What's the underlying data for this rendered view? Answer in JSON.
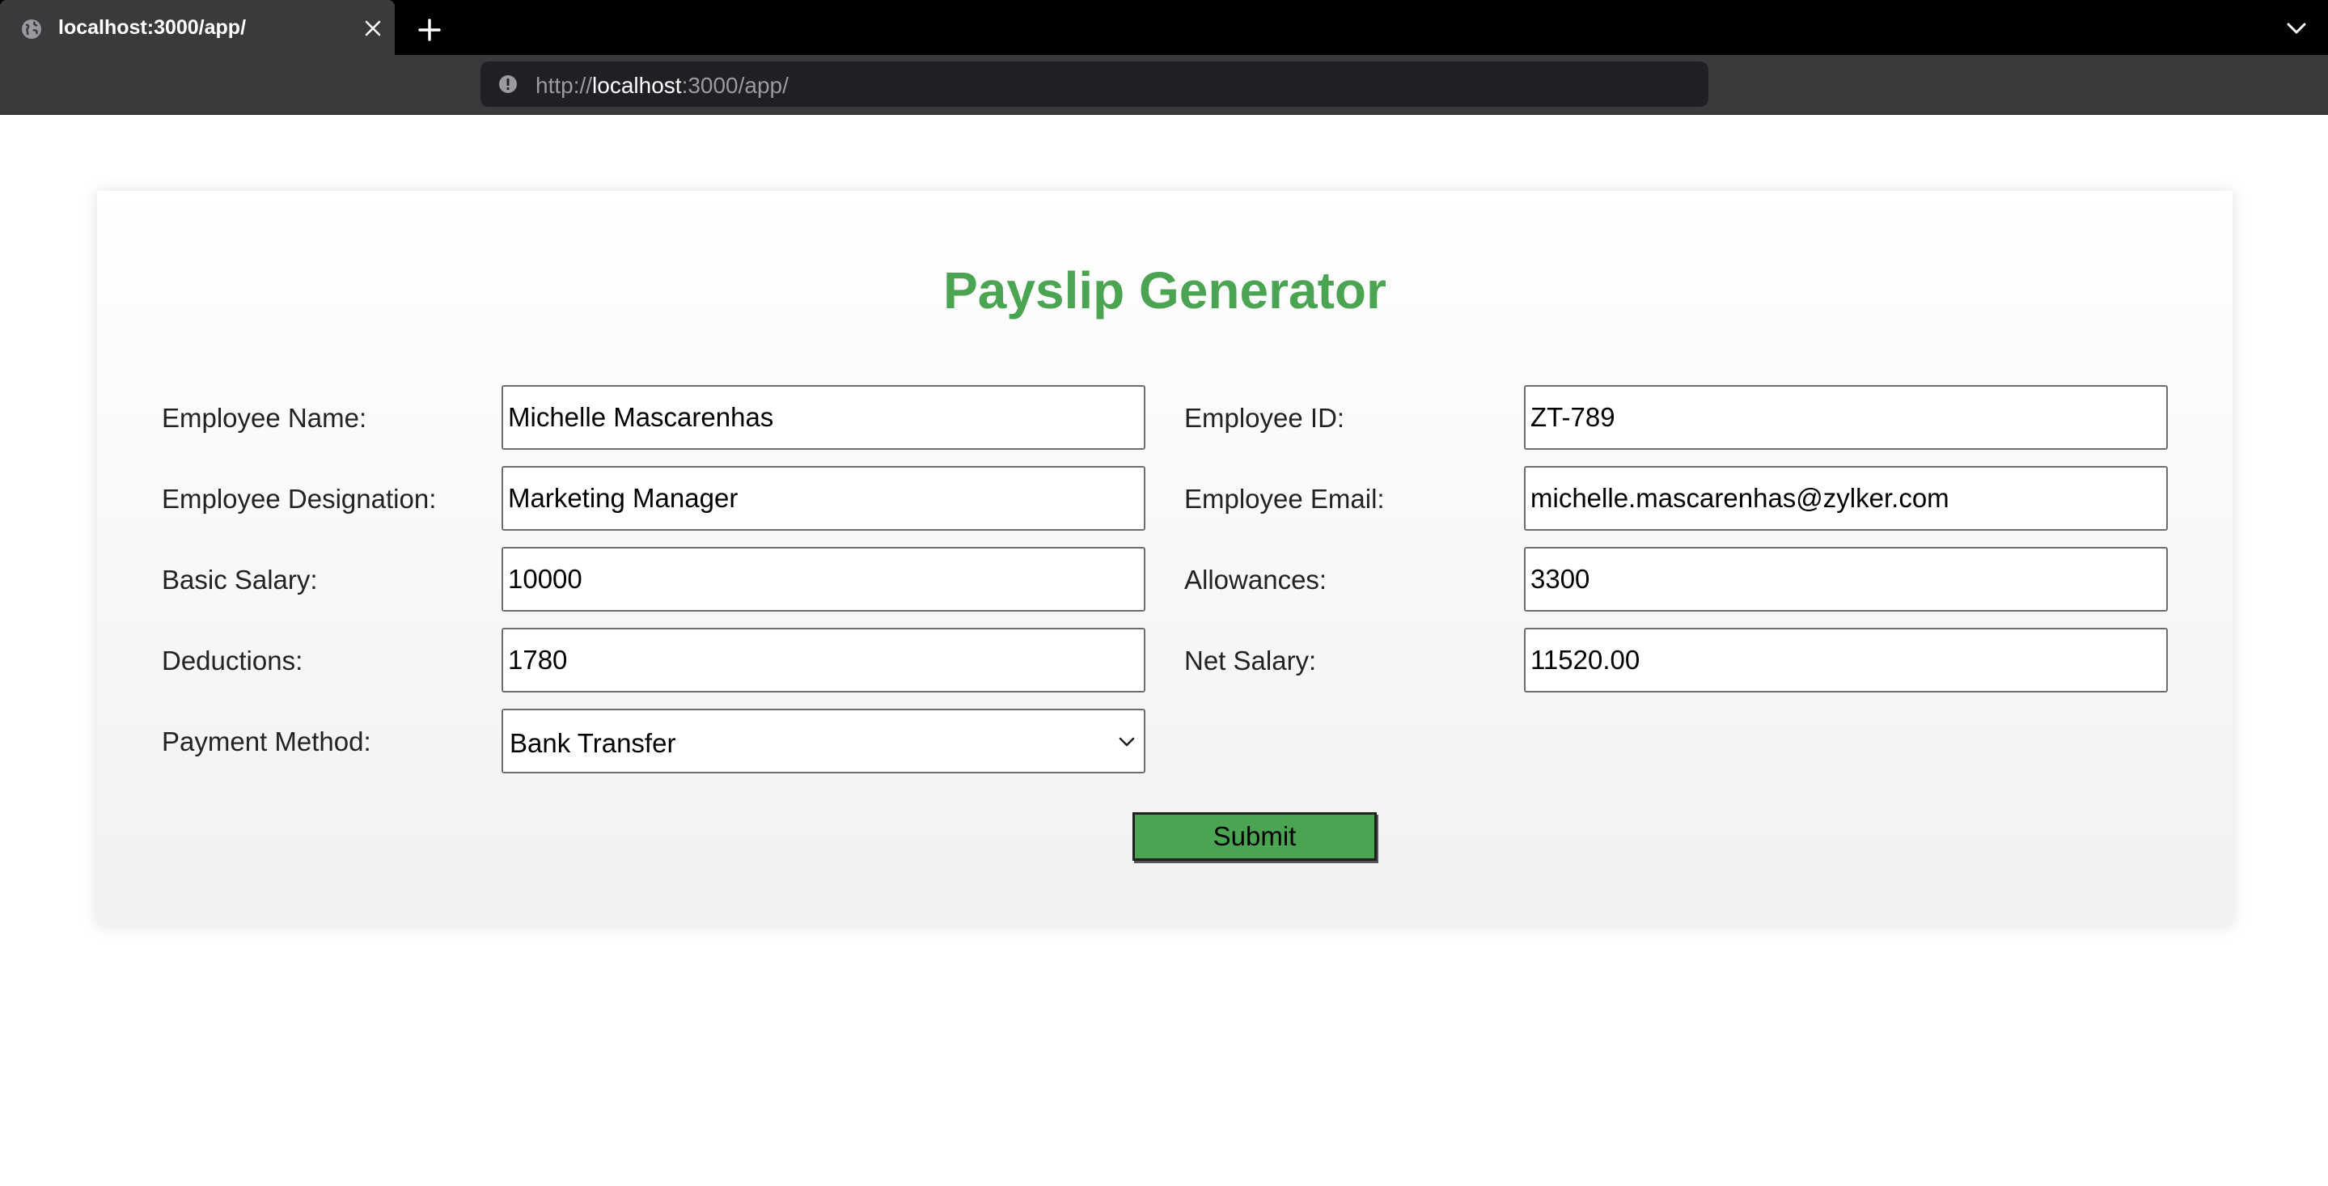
{
  "browser": {
    "tab_title": "localhost:3000/app/",
    "url_scheme": "http://",
    "url_host": "localhost",
    "url_rest": ":3000/app/"
  },
  "page": {
    "title": "Payslip Generator",
    "title_color": "#4aa451",
    "fields": {
      "employee_name": {
        "label": "Employee Name:",
        "value": "Michelle Mascarenhas"
      },
      "employee_id": {
        "label": "Employee ID:",
        "value": "ZT-789"
      },
      "employee_designation": {
        "label": "Employee Designation:",
        "value": "Marketing Manager"
      },
      "employee_email": {
        "label": "Employee Email:",
        "value": "michelle.mascarenhas@zylker.com"
      },
      "basic_salary": {
        "label": "Basic Salary:",
        "value": "10000"
      },
      "allowances": {
        "label": "Allowances:",
        "value": "3300"
      },
      "deductions": {
        "label": "Deductions:",
        "value": "1780"
      },
      "net_salary": {
        "label": "Net Salary:",
        "value": "11520.00"
      },
      "payment_method": {
        "label": "Payment Method:",
        "value": "Bank Transfer"
      }
    },
    "submit_label": "Submit",
    "button_color": "#4aa451"
  }
}
